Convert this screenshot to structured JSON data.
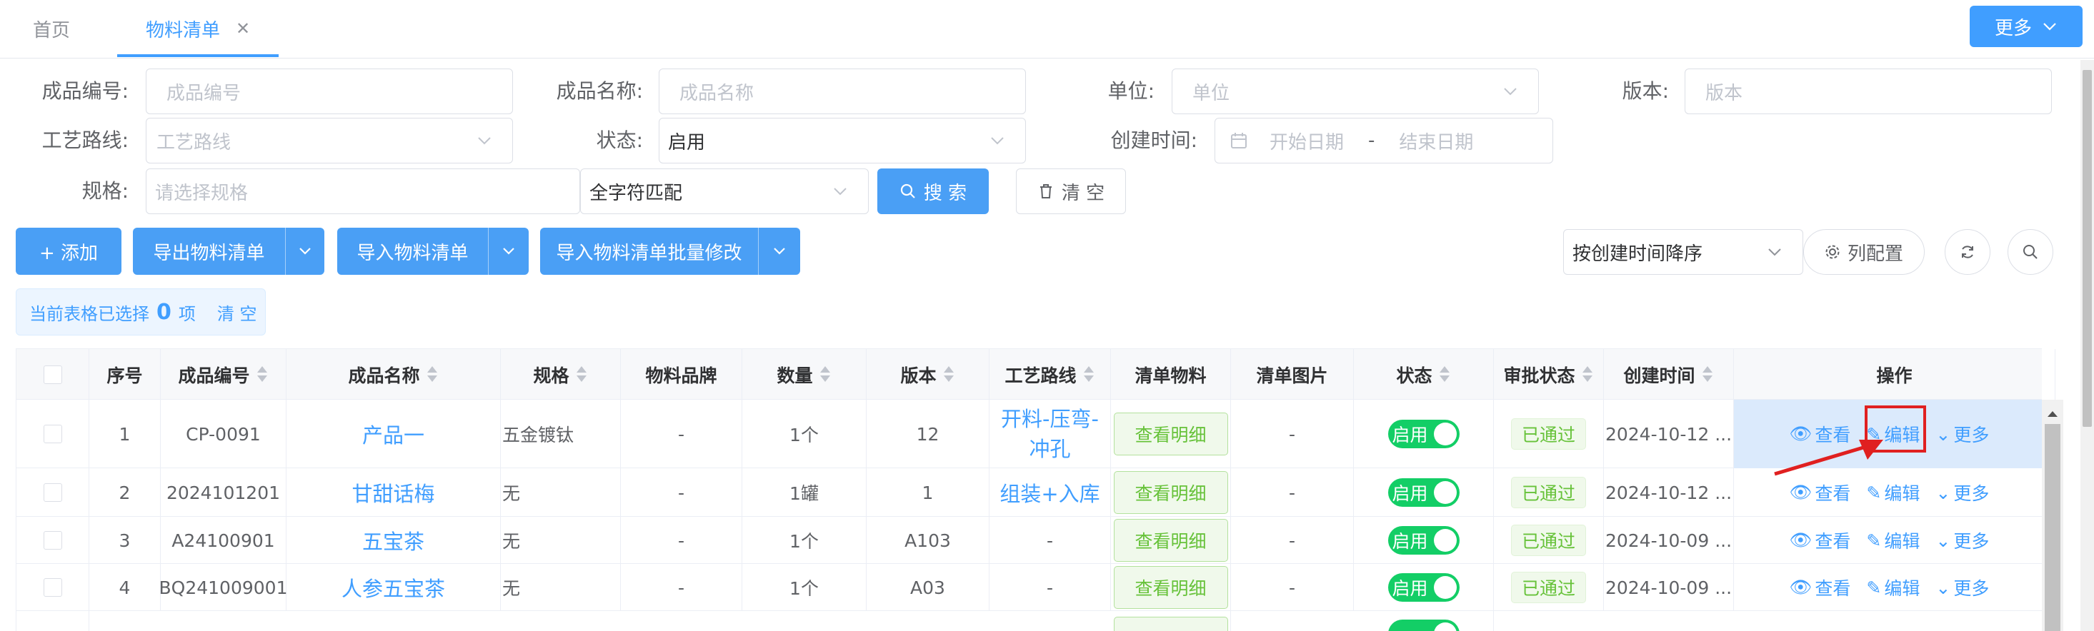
{
  "tabs": [
    {
      "label": "首页",
      "active": false
    },
    {
      "label": "物料清单",
      "active": true,
      "closable": true
    }
  ],
  "top_more_label": "更多",
  "filters": {
    "product_code": {
      "label": "成品编号:",
      "placeholder": "成品编号"
    },
    "product_name": {
      "label": "成品名称:",
      "placeholder": "成品名称"
    },
    "unit": {
      "label": "单位:",
      "placeholder": "单位"
    },
    "version": {
      "label": "版本:",
      "placeholder": "版本"
    },
    "route": {
      "label": "工艺路线:",
      "placeholder": "工艺路线"
    },
    "status": {
      "label": "状态:",
      "value": "启用"
    },
    "created": {
      "label": "创建时间:",
      "start_placeholder": "开始日期",
      "separator": "-",
      "end_placeholder": "结束日期"
    },
    "spec": {
      "label": "规格:",
      "placeholder": "请选择规格"
    },
    "match_mode": "全字符匹配",
    "search_label": "搜 索",
    "clear_label": "清 空"
  },
  "toolbar": {
    "add_label": "+ 添加",
    "export_label": "导出物料清单",
    "import_label": "导入物料清单",
    "import_batch_label": "导入物料清单批量修改",
    "sort_value": "按创建时间降序",
    "column_config_label": "列配置"
  },
  "selection": {
    "prefix": "当前表格已选择",
    "count": "0",
    "suffix": "项",
    "clear": "清 空"
  },
  "columns": [
    "序号",
    "成品编号",
    "成品名称",
    "规格",
    "物料品牌",
    "数量",
    "版本",
    "工艺路线",
    "清单物料",
    "清单图片",
    "状态",
    "审批状态",
    "创建时间",
    "操作"
  ],
  "rows": [
    {
      "index": "1",
      "code": "CP-0091",
      "name": "产品一",
      "spec": "五金镀钛",
      "brand": "-",
      "qty": "1个",
      "version": "12",
      "route": "开料-压弯-冲孔",
      "detail": "查看明细",
      "image": "-",
      "status": "启用",
      "approval": "已通过",
      "created": "2024-10-12 ..."
    },
    {
      "index": "2",
      "code": "2024101201",
      "name": "甘甜话梅",
      "spec": "无",
      "brand": "-",
      "qty": "1罐",
      "version": "1",
      "route": "组装+入库",
      "detail": "查看明细",
      "image": "-",
      "status": "启用",
      "approval": "已通过",
      "created": "2024-10-12 ..."
    },
    {
      "index": "3",
      "code": "A24100901",
      "name": "五宝茶",
      "spec": "无",
      "brand": "-",
      "qty": "1个",
      "version": "A103",
      "route": "-",
      "detail": "查看明细",
      "image": "-",
      "status": "启用",
      "approval": "已通过",
      "created": "2024-10-09 ..."
    },
    {
      "index": "4",
      "code": "BQ241009001",
      "name": "人参五宝茶",
      "spec": "无",
      "brand": "-",
      "qty": "1个",
      "version": "A03",
      "route": "-",
      "detail": "查看明细",
      "image": "-",
      "status": "启用",
      "approval": "已通过",
      "created": "2024-10-09 ..."
    }
  ],
  "row_actions": {
    "view": "查看",
    "edit": "编辑",
    "more": "更多"
  }
}
